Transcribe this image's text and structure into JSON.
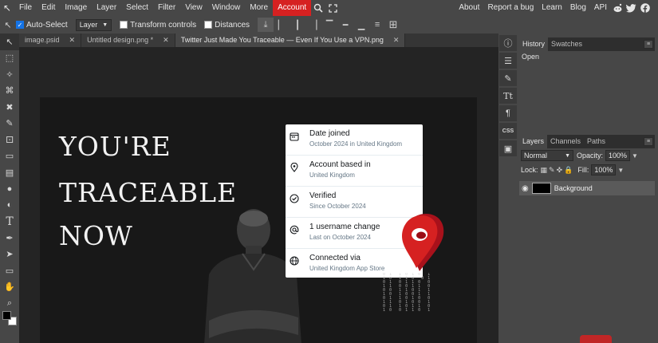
{
  "menu": [
    "File",
    "Edit",
    "Image",
    "Layer",
    "Select",
    "Filter",
    "View",
    "Window",
    "More",
    "Account"
  ],
  "menu_right": [
    "About",
    "Report a bug",
    "Learn",
    "Blog",
    "API"
  ],
  "social_icons": [
    "reddit-icon",
    "twitter-icon",
    "facebook-icon"
  ],
  "options": {
    "auto_select_label": "Auto-Select",
    "auto_select_checked": true,
    "target_value": "Layer",
    "transform_label": "Transform controls",
    "distances_label": "Distances"
  },
  "tabs": [
    {
      "label": "image.psid",
      "active": false
    },
    {
      "label": "Untitled design.png *",
      "active": false
    },
    {
      "label": "Twitter Just Made You Traceable — Even If You Use a VPN.png",
      "active": true
    }
  ],
  "canvas": {
    "headline": [
      "YOU'RE",
      "TRACEABLE",
      "NOW"
    ],
    "rows": [
      {
        "icon": "calendar-icon",
        "title": "Date joined",
        "sub": "October 2024 in United Kingdom"
      },
      {
        "icon": "location-pin-icon",
        "title": "Account based in",
        "sub": "United Kingdom"
      },
      {
        "icon": "verified-check-icon",
        "title": "Verified",
        "sub": "Since October 2024"
      },
      {
        "icon": "at-sign-icon",
        "title": "1 username change",
        "sub": "Last on October 2024"
      },
      {
        "icon": "globe-icon",
        "title": "Connected via",
        "sub": "United Kingdom App Store"
      }
    ]
  },
  "history": {
    "tabs": [
      "History",
      "Swatches"
    ],
    "items": [
      "Open"
    ]
  },
  "layers": {
    "tabs": [
      "Layers",
      "Channels",
      "Paths"
    ],
    "blend_mode": "Normal",
    "opacity_label": "Opacity:",
    "opacity_value": "100%",
    "lock_label": "Lock:",
    "fill_label": "Fill:",
    "fill_value": "100%",
    "items": [
      {
        "name": "Background",
        "visible": true
      }
    ]
  },
  "colors": {
    "accent": "#d62121",
    "panel": "#474747",
    "workspace": "#242424"
  }
}
